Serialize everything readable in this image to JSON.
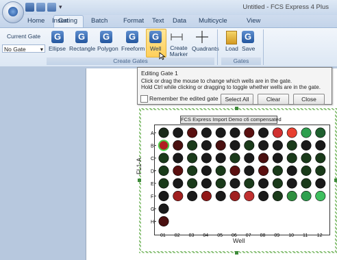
{
  "window": {
    "title": "Untitled - FCS Express 4 Plus"
  },
  "tabs": [
    {
      "label": "Home"
    },
    {
      "label": "Insert"
    },
    {
      "label": "Gating"
    },
    {
      "label": "Batch"
    },
    {
      "label": "Format"
    },
    {
      "label": "Text"
    },
    {
      "label": "Data"
    },
    {
      "label": "Multicycle"
    },
    {
      "label": "View"
    }
  ],
  "ribbon": {
    "current_gate_label": "Current Gate",
    "current_gate_value": "No Gate",
    "create_gates": {
      "label": "Create Gates",
      "buttons": [
        "Ellipse",
        "Rectangle",
        "Polygon",
        "Freeform",
        "Well",
        "Create Marker",
        "Quadrants"
      ]
    },
    "gates": {
      "label": "Gates",
      "buttons": [
        "Load",
        "Save"
      ]
    }
  },
  "dialog": {
    "title": "Editing Gate 1",
    "line1": "Click or drag the mouse to change which wells are in the gate.",
    "line2": "Hold Ctrl while clicking or dragging to toggle whether wells are in the gate.",
    "checkbox_label": "Remember the edited gate",
    "checkbox_checked": false,
    "buttons": {
      "select_all": "Select All",
      "clear": "Clear",
      "close": "Close"
    }
  },
  "chart_data": {
    "type": "heatmap",
    "title": "FCS Express Import Demo c6 compensated",
    "xlabel": "Well",
    "ylabel": "FL1-A",
    "columns": [
      "01",
      "02",
      "03",
      "04",
      "05",
      "06",
      "07",
      "08",
      "09",
      "10",
      "11",
      "12"
    ],
    "rows": [
      "A",
      "B",
      "C",
      "D",
      "E",
      "F",
      "G",
      "H"
    ],
    "wells": {
      "A": [
        "#1a2a1a",
        "#1a1a1a",
        "#5a1010",
        "#1a1a1a",
        "#1a1a1a",
        "#1a1a1a",
        "#5a1010",
        "#1a1a1a",
        "#d03030",
        "#e84030",
        "#2f9f4f",
        "#1f5f2f"
      ],
      "B": [
        "#b02020",
        "#4a1010",
        "#1a3a1a",
        "#1a1a1a",
        "#4a1010",
        "#1a1a1a",
        "#1a3a1a",
        "#1a1a1a",
        "#1a1a1a",
        "#1a3a1a",
        "#1a1a1a",
        "#1a1a1a"
      ],
      "C": [
        "#1a3a1a",
        "#1a1a1a",
        "#1a3a1a",
        "#1a1a1a",
        "#1a1a1a",
        "#1a3a1a",
        "#1a1a1a",
        "#4a1010",
        "#1a1a1a",
        "#1a3a1a",
        "#1a3a1a",
        "#1a3a1a"
      ],
      "D": [
        "#1a3a1a",
        "#5a1010",
        "#1a3a1a",
        "#1a1a1a",
        "#1a3a1a",
        "#5a1010",
        "#1a1a1a",
        "#5a1010",
        "#1a3a1a",
        "#1a1a1a",
        "#1a3a1a",
        "#1a3a1a"
      ],
      "E": [
        "#1a3a1a",
        "#1a1a1a",
        "#1a3a1a",
        "#1a1a1a",
        "#1a3a1a",
        "#1a1a1a",
        "#1a3a1a",
        "#1a1a1a",
        "#1a3a1a",
        "#1a1a1a",
        "#1a3a1a",
        "#1a1a1a"
      ],
      "F": [
        "#1a1a1a",
        "#a02020",
        "#1a1a1a",
        "#901818",
        "#1a1a1a",
        "#a02020",
        "#c03030",
        "#1a1a1a",
        "#1a3a1a",
        "#2f8f3f",
        "#2fa04f",
        "#3fbf5f"
      ],
      "G": [
        "#1a1a1a"
      ],
      "H": [
        "#4a1010"
      ]
    },
    "selected_well": "B01",
    "grid": false
  }
}
